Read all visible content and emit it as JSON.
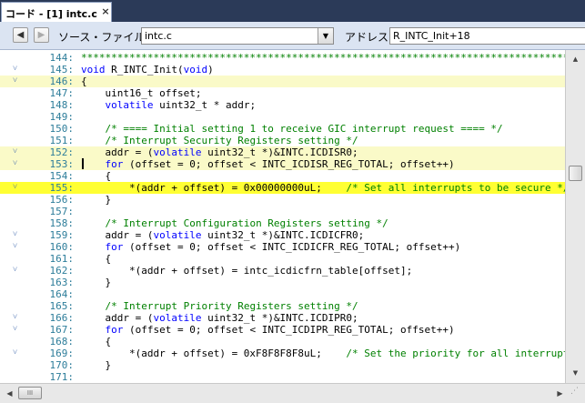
{
  "tab": {
    "title": "コード - [1] intc.c",
    "close_icon": "×"
  },
  "toolbar": {
    "back_icon": "◀",
    "forward_icon": "▶",
    "source_file_label": "ソース・ファイル",
    "source_file_value": "intc.c",
    "dropdown_icon": "▼",
    "address_label": "アドレス",
    "address_value": "R_INTC_Init+18"
  },
  "scrollbar": {
    "up_icon": "▲",
    "down_icon": "▼",
    "left_icon": "◀",
    "right_icon": "▶",
    "thumb_grip": "III",
    "resize_grip": "⋰"
  },
  "code": {
    "fold_icon": "˅",
    "lines": [
      {
        "num": "144:",
        "fold": "",
        "hl": "",
        "tokens": [
          {
            "t": "cm",
            "s": "***********************************************************************************"
          }
        ]
      },
      {
        "num": "145:",
        "fold": "˅",
        "hl": "",
        "tokens": [
          {
            "t": "kw",
            "s": "void"
          },
          {
            "t": "",
            "s": " R_INTC_Init("
          },
          {
            "t": "kw",
            "s": "void"
          },
          {
            "t": "",
            "s": ")"
          }
        ]
      },
      {
        "num": "146:",
        "fold": "˅",
        "hl": "light",
        "tokens": [
          {
            "t": "",
            "s": "{"
          }
        ]
      },
      {
        "num": "147:",
        "fold": "",
        "hl": "",
        "tokens": [
          {
            "t": "",
            "s": "    uint16_t offset;"
          }
        ]
      },
      {
        "num": "148:",
        "fold": "",
        "hl": "",
        "tokens": [
          {
            "t": "",
            "s": "    "
          },
          {
            "t": "kw",
            "s": "volatile"
          },
          {
            "t": "",
            "s": " uint32_t * addr;"
          }
        ]
      },
      {
        "num": "149:",
        "fold": "",
        "hl": "",
        "tokens": []
      },
      {
        "num": "150:",
        "fold": "",
        "hl": "",
        "tokens": [
          {
            "t": "",
            "s": "    "
          },
          {
            "t": "cm",
            "s": "/* ==== Initial setting 1 to receive GIC interrupt request ==== */"
          }
        ]
      },
      {
        "num": "151:",
        "fold": "",
        "hl": "",
        "tokens": [
          {
            "t": "",
            "s": "    "
          },
          {
            "t": "cm",
            "s": "/* Interrupt Security Registers setting */"
          }
        ]
      },
      {
        "num": "152:",
        "fold": "˅",
        "hl": "light",
        "tokens": [
          {
            "t": "",
            "s": "    addr = ("
          },
          {
            "t": "kw",
            "s": "volatile"
          },
          {
            "t": "",
            "s": " uint32_t *)&INTC.ICDISR0;"
          }
        ]
      },
      {
        "num": "153:",
        "fold": "˅",
        "hl": "light",
        "caret": true,
        "tokens": [
          {
            "t": "",
            "s": "    "
          },
          {
            "t": "kw",
            "s": "for"
          },
          {
            "t": "",
            "s": " (offset = 0; offset < INTC_ICDISR_REG_TOTAL; offset++)"
          }
        ]
      },
      {
        "num": "154:",
        "fold": "",
        "hl": "",
        "tokens": [
          {
            "t": "",
            "s": "    {"
          }
        ]
      },
      {
        "num": "155:",
        "fold": "˅",
        "hl": "bright",
        "tokens": [
          {
            "t": "",
            "s": "        *(addr + offset) = 0x00000000uL;    "
          },
          {
            "t": "cm",
            "s": "/* Set all interrupts to be secure */"
          }
        ]
      },
      {
        "num": "156:",
        "fold": "",
        "hl": "",
        "tokens": [
          {
            "t": "",
            "s": "    }"
          }
        ]
      },
      {
        "num": "157:",
        "fold": "",
        "hl": "",
        "tokens": []
      },
      {
        "num": "158:",
        "fold": "",
        "hl": "",
        "tokens": [
          {
            "t": "",
            "s": "    "
          },
          {
            "t": "cm",
            "s": "/* Interrupt Configuration Registers setting */"
          }
        ]
      },
      {
        "num": "159:",
        "fold": "˅",
        "hl": "",
        "tokens": [
          {
            "t": "",
            "s": "    addr = ("
          },
          {
            "t": "kw",
            "s": "volatile"
          },
          {
            "t": "",
            "s": " uint32_t *)&INTC.ICDICFR0;"
          }
        ]
      },
      {
        "num": "160:",
        "fold": "˅",
        "hl": "",
        "tokens": [
          {
            "t": "",
            "s": "    "
          },
          {
            "t": "kw",
            "s": "for"
          },
          {
            "t": "",
            "s": " (offset = 0; offset < INTC_ICDICFR_REG_TOTAL; offset++)"
          }
        ]
      },
      {
        "num": "161:",
        "fold": "",
        "hl": "",
        "tokens": [
          {
            "t": "",
            "s": "    {"
          }
        ]
      },
      {
        "num": "162:",
        "fold": "˅",
        "hl": "",
        "tokens": [
          {
            "t": "",
            "s": "        *(addr + offset) = intc_icdicfrn_table[offset];"
          }
        ]
      },
      {
        "num": "163:",
        "fold": "",
        "hl": "",
        "tokens": [
          {
            "t": "",
            "s": "    }"
          }
        ]
      },
      {
        "num": "164:",
        "fold": "",
        "hl": "",
        "tokens": []
      },
      {
        "num": "165:",
        "fold": "",
        "hl": "",
        "tokens": [
          {
            "t": "",
            "s": "    "
          },
          {
            "t": "cm",
            "s": "/* Interrupt Priority Registers setting */"
          }
        ]
      },
      {
        "num": "166:",
        "fold": "˅",
        "hl": "",
        "tokens": [
          {
            "t": "",
            "s": "    addr = ("
          },
          {
            "t": "kw",
            "s": "volatile"
          },
          {
            "t": "",
            "s": " uint32_t *)&INTC.ICDIPR0;"
          }
        ]
      },
      {
        "num": "167:",
        "fold": "˅",
        "hl": "",
        "tokens": [
          {
            "t": "",
            "s": "    "
          },
          {
            "t": "kw",
            "s": "for"
          },
          {
            "t": "",
            "s": " (offset = 0; offset < INTC_ICDIPR_REG_TOTAL; offset++)"
          }
        ]
      },
      {
        "num": "168:",
        "fold": "",
        "hl": "",
        "tokens": [
          {
            "t": "",
            "s": "    {"
          }
        ]
      },
      {
        "num": "169:",
        "fold": "˅",
        "hl": "",
        "tokens": [
          {
            "t": "",
            "s": "        *(addr + offset) = 0xF8F8F8F8uL;    "
          },
          {
            "t": "cm",
            "s": "/* Set the priority for all interrupts */"
          }
        ]
      },
      {
        "num": "170:",
        "fold": "",
        "hl": "",
        "tokens": [
          {
            "t": "",
            "s": "    }"
          }
        ]
      },
      {
        "num": "171:",
        "fold": "",
        "hl": "",
        "tokens": []
      }
    ]
  }
}
